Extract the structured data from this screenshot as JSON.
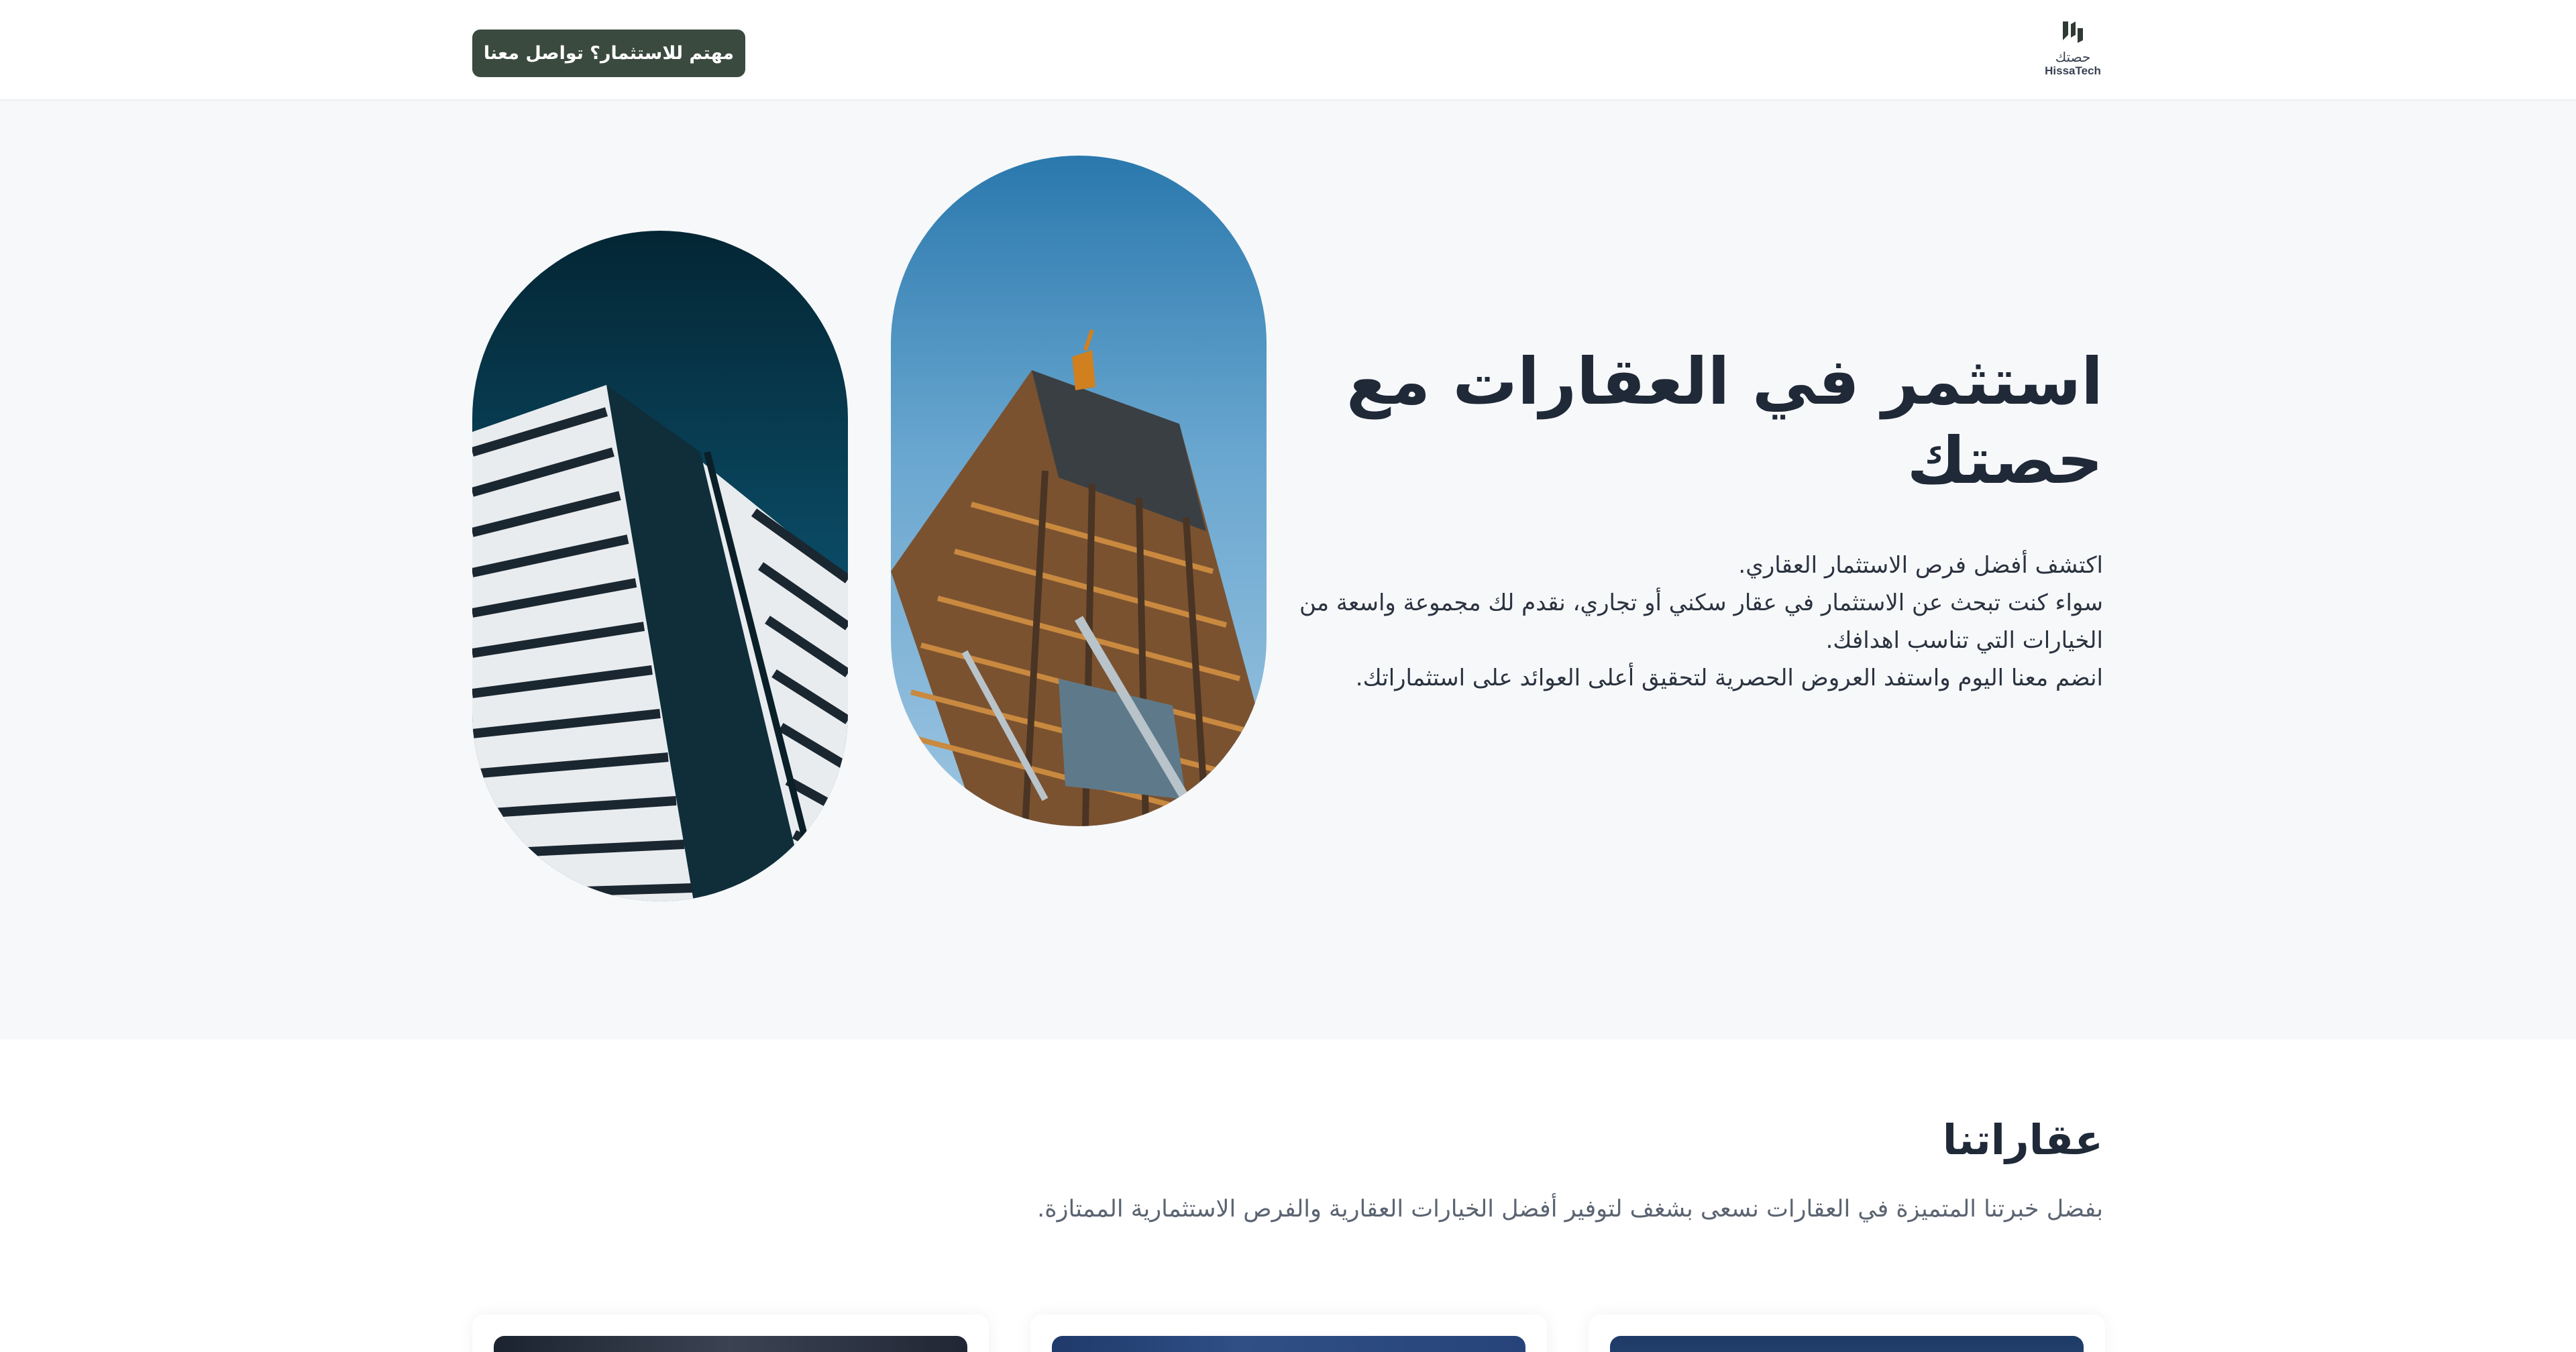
{
  "header": {
    "logo_arabic": "حصتك",
    "logo_latin": "HissaTech",
    "cta_label": "مهتم للاستثمار؟ تواصل معنا"
  },
  "hero": {
    "title": "استثمر في العقارات مع حصتك",
    "paragraph_lines": [
      "اكتشف أفضل فرص الاستثمار العقاري.",
      "سواء كنت تبحث عن الاستثمار في عقار سكني أو تجاري، نقدم لك مجموعة واسعة من الخيارات التي تناسب اهدافك.",
      "انضم معنا اليوم واستفد العروض الحصرية لتحقيق أعلى العوائد على استثماراتك."
    ]
  },
  "properties": {
    "title": "عقاراتنا",
    "subtitle": "بفضل خبرتنا المتميزة في العقارات نسعى بشغف لتوفير أفضل الخيارات العقارية والفرص الاستثمارية الممتازة."
  },
  "colors": {
    "accent": "#3b4a3f",
    "hero_background": "#f7f8fa",
    "text_dark": "#1f2937"
  },
  "icons": {
    "logo": "hissatech-logo-icon"
  }
}
